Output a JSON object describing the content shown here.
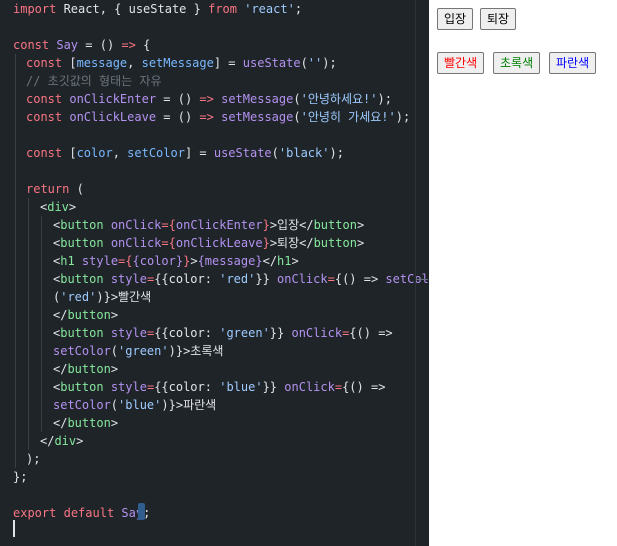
{
  "code": {
    "l1": [
      "import",
      " React, { ",
      "useState",
      " } ",
      "from",
      " ",
      "'react'",
      ";"
    ],
    "l3": [
      "const",
      " ",
      "Say",
      " = () ",
      "=>",
      " {"
    ],
    "l4": [
      "const",
      " [",
      "message",
      ", ",
      "setMessage",
      "] = ",
      "useState",
      "(",
      "''",
      ");"
    ],
    "l5": "// 초깃값의 형태는 자유",
    "l6": [
      "const",
      " ",
      "onClickEnter",
      " = () ",
      "=>",
      " ",
      "setMessage",
      "(",
      "'안녕하세요!'",
      ");"
    ],
    "l7": [
      "const",
      " ",
      "onClickLeave",
      " = () ",
      "=>",
      " ",
      "setMessage",
      "(",
      "'안녕히 가세요!'",
      ");"
    ],
    "l9": [
      "const",
      " [",
      "color",
      ", ",
      "setColor",
      "] = ",
      "useState",
      "(",
      "'black'",
      ");"
    ],
    "l11": [
      "return",
      " ("
    ],
    "l12": [
      "<",
      "div",
      ">"
    ],
    "l13": [
      "<",
      "button",
      " ",
      "onClick",
      "=",
      "{",
      "onClickEnter",
      "}",
      ">입장</",
      "button",
      ">"
    ],
    "l14": [
      "<",
      "button",
      " ",
      "onClick",
      "=",
      "{",
      "onClickLeave",
      "}",
      ">퇴장</",
      "button",
      ">"
    ],
    "l15": [
      "<",
      "h1",
      " ",
      "style",
      "=",
      "{",
      "{color}",
      "}",
      ">",
      "{message}",
      "</",
      "h1",
      ">"
    ],
    "l16": [
      "<",
      "button",
      " ",
      "style",
      "=",
      "{{color: ",
      "'red'",
      "}}",
      " ",
      "onClick",
      "=",
      "{() => ",
      "setColor"
    ],
    "l17": [
      "(",
      "'red'",
      ")}",
      ">빨간색"
    ],
    "l18": [
      "</",
      "button",
      ">"
    ],
    "l19": [
      "<",
      "button",
      " ",
      "style",
      "=",
      "{{color: ",
      "'green'",
      "}}",
      " ",
      "onClick",
      "=",
      "{() =>"
    ],
    "l20": [
      "setColor",
      "(",
      "'green'",
      ")}",
      ">초록색"
    ],
    "l21": [
      "</",
      "button",
      ">"
    ],
    "l22": [
      "<",
      "button",
      " ",
      "style",
      "=",
      "{{color: ",
      "'blue'",
      "}}",
      " ",
      "onClick",
      "=",
      "{() =>"
    ],
    "l23": [
      "setColor",
      "(",
      "'blue'",
      ")}",
      ">파란색"
    ],
    "l24": [
      "</",
      "button",
      ">"
    ],
    "l25": [
      "</",
      "div",
      ">"
    ],
    "l26": ");",
    "l27": "};",
    "l29": [
      "export",
      " ",
      "default",
      " ",
      "Say",
      ";"
    ]
  },
  "preview": {
    "enter_label": "입장",
    "leave_label": "퇴장",
    "message": "",
    "red_label": "빨간색",
    "green_label": "초록색",
    "blue_label": "파란색",
    "colors": {
      "red": "#ff0000",
      "green": "#008000",
      "blue": "#0000ff",
      "button_bg": "#efefef",
      "editor_bg": "#1f2428"
    }
  }
}
